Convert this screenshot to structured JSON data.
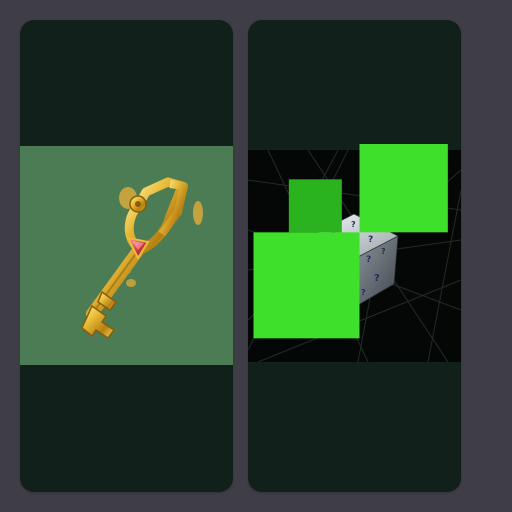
{
  "colors": {
    "page_background": "#3f3e47",
    "card_background": "#12201b",
    "key_art_background": "#4c7c53",
    "cube_art_background": "#050706",
    "gold": "#d4a323",
    "gem": "#d83a42",
    "badge_green": "#3ee02c"
  },
  "cards": [
    {
      "name": "key-card",
      "icon": "golden-key-with-red-gem",
      "label": ""
    },
    {
      "name": "cube-card",
      "icon": "mystery-question-mark-cube",
      "badge_icon": "green-pixel-badge",
      "label": ""
    }
  ]
}
